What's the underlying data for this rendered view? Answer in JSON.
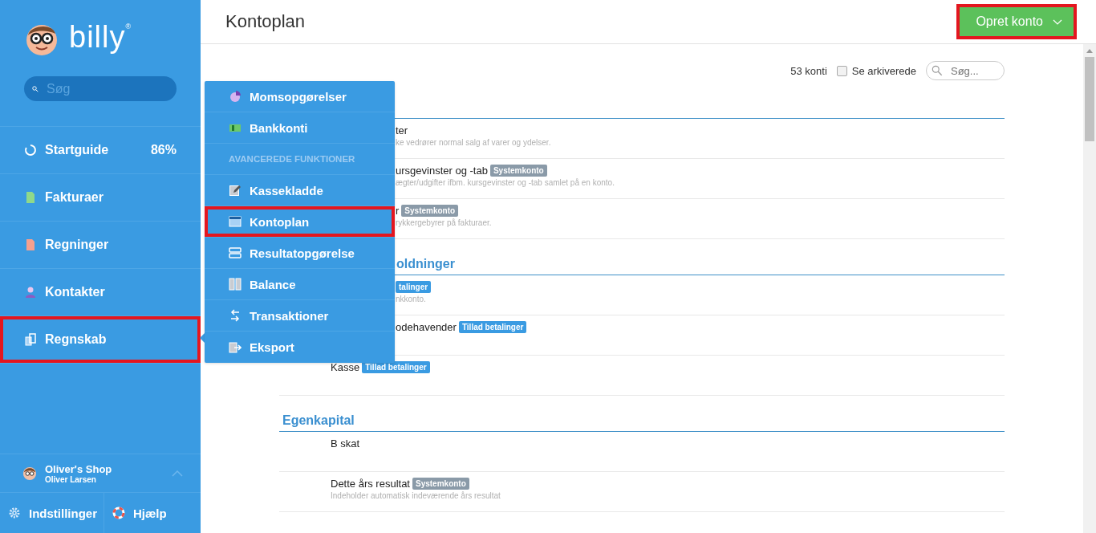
{
  "sidebar": {
    "logo": "billy",
    "logo_mark": "®",
    "search": {
      "placeholder": "Søg"
    },
    "nav": [
      {
        "label": "Startguide",
        "badge": "86%",
        "highlighted": false
      },
      {
        "label": "Fakturaer",
        "highlighted": false
      },
      {
        "label": "Regninger",
        "highlighted": false
      },
      {
        "label": "Kontakter",
        "highlighted": false
      },
      {
        "label": "Regnskab",
        "highlighted": true
      }
    ],
    "account": {
      "shop": "Oliver's Shop",
      "user": "Oliver Larsen"
    },
    "footer": [
      {
        "label": "Indstillinger"
      },
      {
        "label": "Hjælp"
      }
    ]
  },
  "header": {
    "title": "Kontoplan",
    "create_button": {
      "label": "Opret konto",
      "highlighted": true
    }
  },
  "toolbar": {
    "count": "53 konti",
    "archived": {
      "label": "Se arkiverede",
      "checked": false
    },
    "search": {
      "placeholder": "Søg..."
    }
  },
  "sections": [
    {
      "rows": [
        {
          "kind": "partial",
          "name": "ter",
          "description": "ke vedrører normal salg af varer og ydelser."
        },
        {
          "kind": "partial",
          "name": "ursgevinster og -tab",
          "tags": [
            {
              "label": "Systemkonto",
              "kind": "system"
            }
          ],
          "description": "ægter/udgifter ifbm. kursgevinster og -tab samlet på en konto."
        },
        {
          "kind": "partial",
          "name": "r",
          "tags": [
            {
              "label": "Systemkonto",
              "kind": "system"
            }
          ],
          "description": "rykkergebyrer på fakturaer."
        }
      ]
    },
    {
      "heading": "oldninger",
      "kind": "partial",
      "rows": [
        {
          "kind": "partial",
          "tags": [
            {
              "label": "talinger",
              "kind": "payment"
            }
          ],
          "description": "nkkonto."
        },
        {
          "kind": "partial",
          "name": "odehavender",
          "tags": [
            {
              "label": "Tillad betalinger",
              "kind": "payment"
            }
          ]
        },
        {
          "kind": "full",
          "name": "Kasse",
          "tags": [
            {
              "label": "Tillad betalinger",
              "kind": "payment"
            }
          ]
        }
      ]
    },
    {
      "heading": "Egenkapital",
      "kind": "full",
      "rows": [
        {
          "kind": "full",
          "name": "B skat"
        },
        {
          "kind": "full",
          "name": "Dette års resultat",
          "tags": [
            {
              "label": "Systemkonto",
              "kind": "system"
            }
          ],
          "description": "Indeholder automatisk indeværende års resultat"
        }
      ]
    }
  ],
  "flyout": {
    "items": [
      {
        "kind": "link",
        "label": "Momsopgørelser",
        "highlighted": false
      },
      {
        "kind": "link",
        "label": "Bankkonti",
        "highlighted": false
      },
      {
        "kind": "header",
        "label": "AVANCEREDE FUNKTIONER"
      },
      {
        "kind": "link",
        "label": "Kassekladde",
        "highlighted": false
      },
      {
        "kind": "link",
        "label": "Kontoplan",
        "highlighted": true
      },
      {
        "kind": "link",
        "label": "Resultatopgørelse",
        "highlighted": false
      },
      {
        "kind": "link",
        "label": "Balance",
        "highlighted": false
      },
      {
        "kind": "link",
        "label": "Transaktioner",
        "highlighted": false
      },
      {
        "kind": "link",
        "label": "Eksport",
        "highlighted": false
      }
    ]
  }
}
